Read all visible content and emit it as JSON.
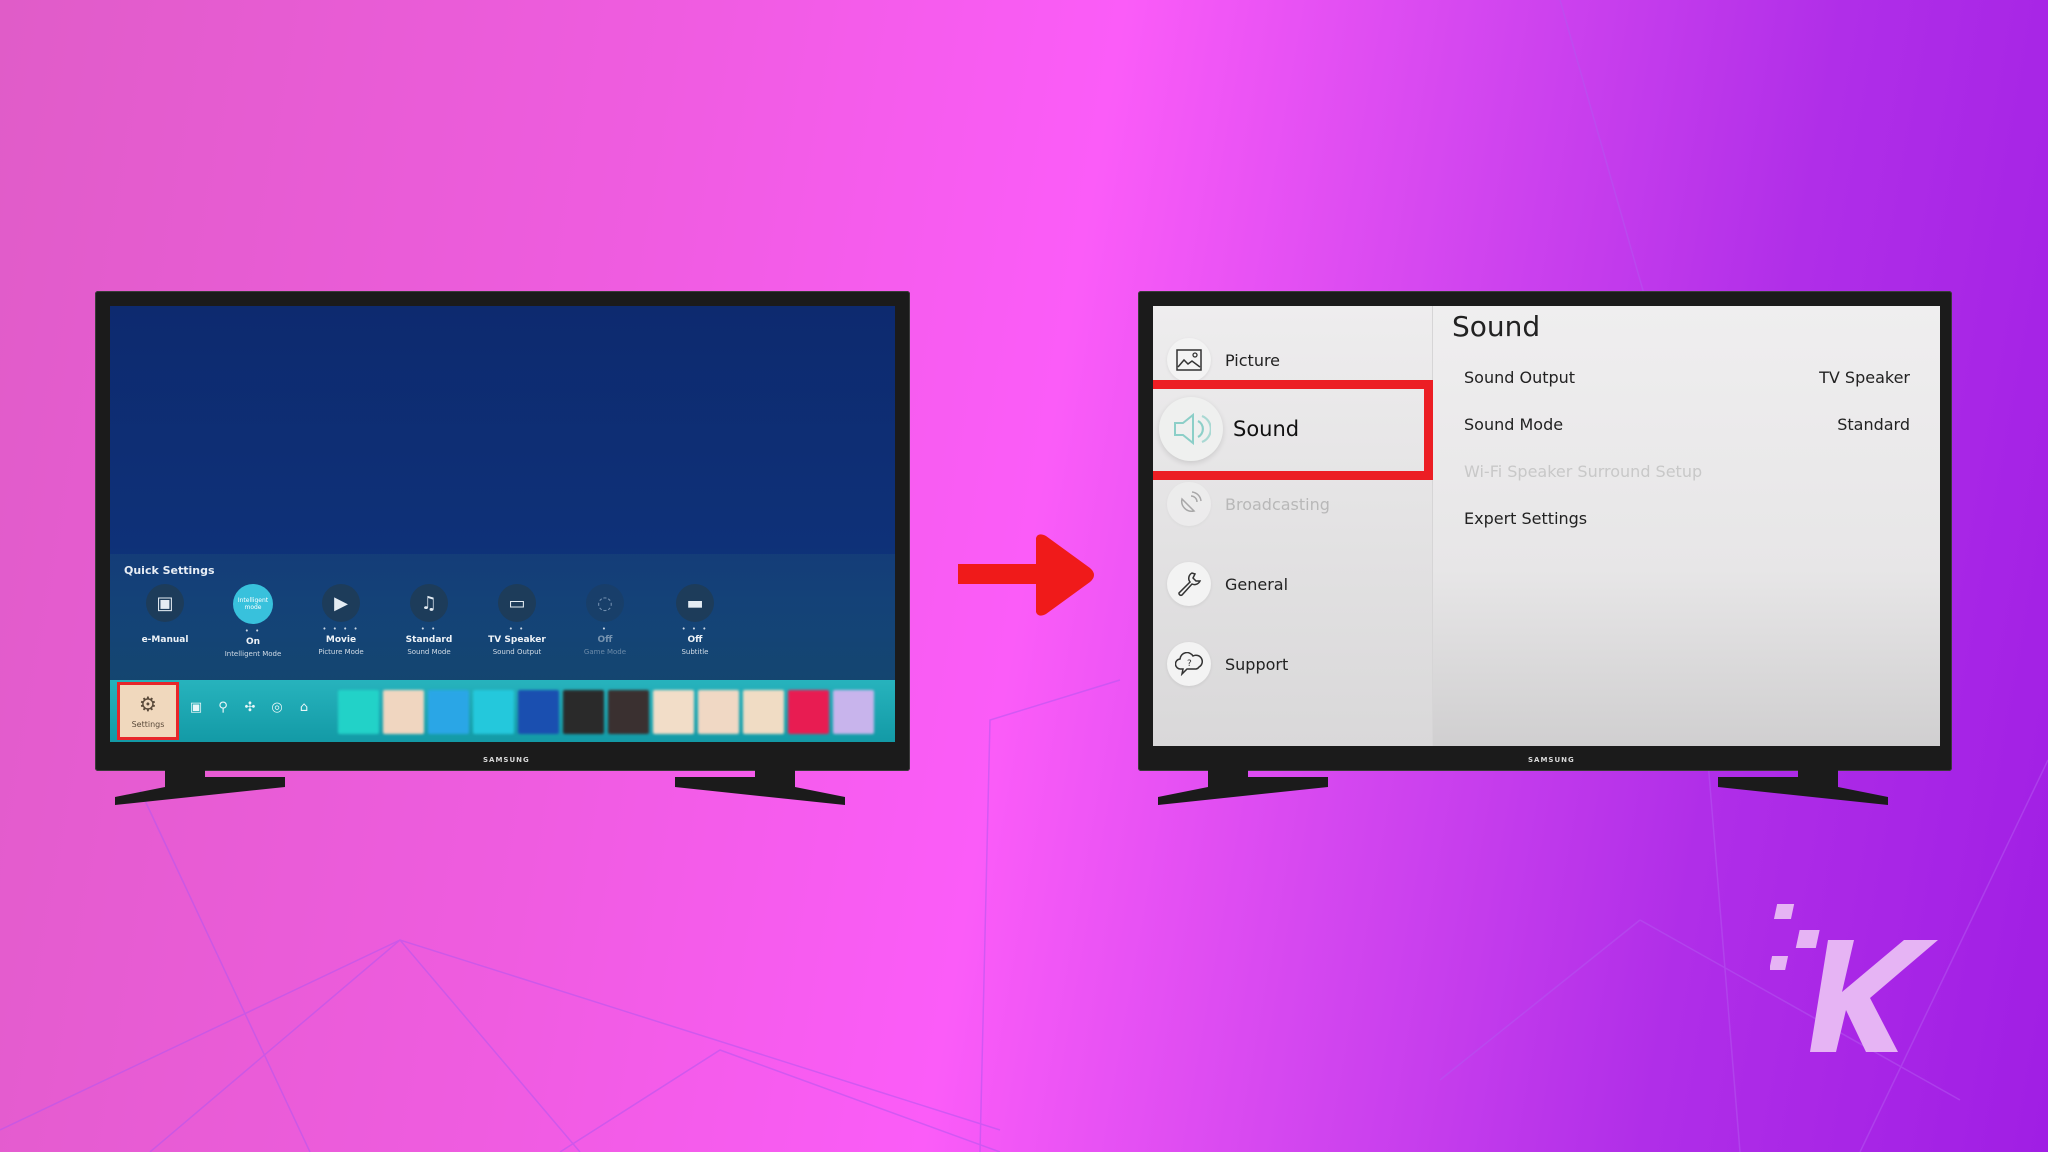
{
  "colors": {
    "accent_red": "#ec1e24",
    "logo": "#e6b4f4"
  },
  "left_tv": {
    "brand": "SAMSUNG",
    "quick_settings": {
      "title": "Quick Settings",
      "items": [
        {
          "icon": "e-manual-icon",
          "dots": "",
          "value": "e-Manual",
          "label": ""
        },
        {
          "icon": "intelligent-mode-icon",
          "dots": "• •",
          "value": "On",
          "label": "Intelligent Mode",
          "active": true,
          "icon_text": "Intelligent mode"
        },
        {
          "icon": "play-icon",
          "dots": "• • • •",
          "value": "Movie",
          "label": "Picture Mode"
        },
        {
          "icon": "sound-mode-icon",
          "dots": "• •",
          "value": "Standard",
          "label": "Sound Mode"
        },
        {
          "icon": "tv-speaker-icon",
          "dots": "• •",
          "value": "TV Speaker",
          "label": "Sound Output"
        },
        {
          "icon": "game-mode-icon",
          "dots": "•",
          "value": "Off",
          "label": "Game Mode",
          "disabled": true
        },
        {
          "icon": "subtitle-icon",
          "dots": "• • •",
          "value": "Off",
          "label": "Subtitle"
        }
      ]
    },
    "smart_bar": {
      "settings_label": "Settings",
      "icons": [
        "source-icon",
        "search-icon",
        "apps-icon",
        "ambient-icon",
        "home-icon"
      ],
      "app_tile_colors": [
        "#22d2c8",
        "#f0d6c0",
        "#2aa6e6",
        "#24c8dc",
        "#1a4fb0",
        "#2a2a2a",
        "#3a3030",
        "#f2ddc8",
        "#f0d8c4",
        "#f0dcc4",
        "#e81c52",
        "#c8b4ec"
      ]
    }
  },
  "right_tv": {
    "brand": "SAMSUNG",
    "menu": [
      {
        "label": "Picture",
        "icon": "picture-icon"
      },
      {
        "label": "Sound",
        "icon": "speaker-icon",
        "selected": true
      },
      {
        "label": "Broadcasting",
        "icon": "broadcasting-icon",
        "disabled": true
      },
      {
        "label": "General",
        "icon": "wrench-icon"
      },
      {
        "label": "Support",
        "icon": "support-icon"
      }
    ],
    "panel": {
      "title": "Sound",
      "options": [
        {
          "label": "Sound Output",
          "value": "TV Speaker"
        },
        {
          "label": "Sound Mode",
          "value": "Standard"
        },
        {
          "label": "Wi-Fi Speaker Surround Setup",
          "value": "",
          "disabled": true
        },
        {
          "label": "Expert Settings",
          "value": ""
        }
      ]
    }
  }
}
